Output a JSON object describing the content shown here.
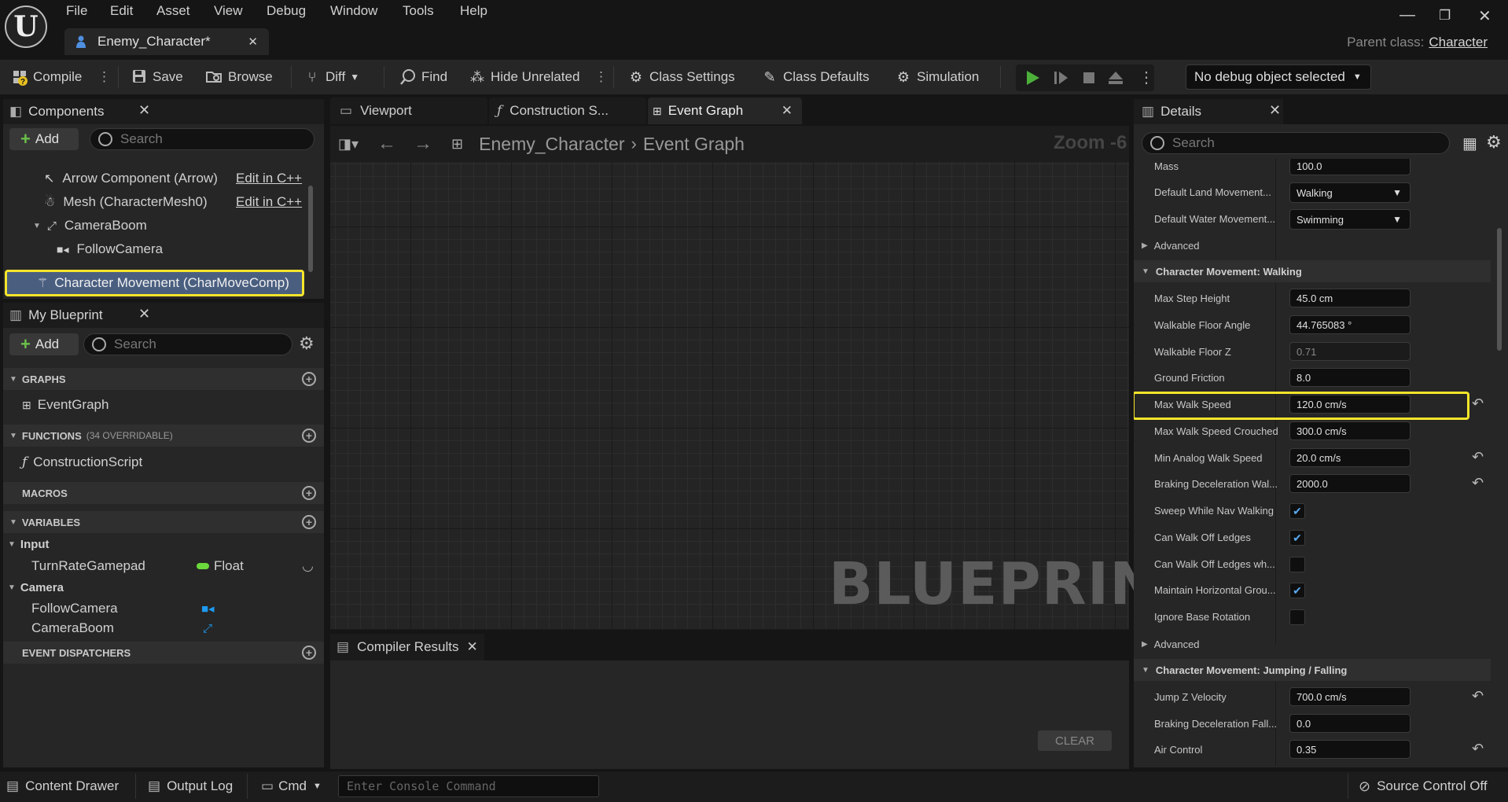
{
  "menu": [
    "File",
    "Edit",
    "Asset",
    "View",
    "Debug",
    "Window",
    "Tools",
    "Help"
  ],
  "document_tab": {
    "label": "Enemy_Character*",
    "close": "✕"
  },
  "parent_class": {
    "prefix": "Parent class:",
    "value": "Character"
  },
  "window_controls": {
    "minimize": "—",
    "restore": "❐",
    "close": "✕"
  },
  "toolbar": {
    "compile": "Compile",
    "save": "Save",
    "browse": "Browse",
    "diff": "Diff",
    "find": "Find",
    "hide_unrelated": "Hide Unrelated",
    "class_settings": "Class Settings",
    "class_defaults": "Class Defaults",
    "simulation": "Simulation",
    "debug_object": "No debug object selected"
  },
  "components_panel": {
    "title": "Components",
    "add": "Add",
    "search_placeholder": "Search",
    "items": [
      {
        "label": "Arrow Component (Arrow)",
        "edit": "Edit in C++"
      },
      {
        "label": "Mesh (CharacterMesh0)",
        "edit": "Edit in C++"
      },
      {
        "label": "CameraBoom"
      },
      {
        "label": "FollowCamera"
      },
      {
        "label": "Character Movement (CharMoveComp)"
      }
    ]
  },
  "my_blueprint": {
    "title": "My Blueprint",
    "add": "Add",
    "search_placeholder": "Search",
    "graphs_header": "GRAPHS",
    "graph_item": "EventGraph",
    "functions_header": "FUNCTIONS",
    "functions_count": "(34 OVERRIDABLE)",
    "function_item": "ConstructionScript",
    "macros_header": "MACROS",
    "variables_header": "VARIABLES",
    "var_group_input": "Input",
    "var_turn": "TurnRateGamepad",
    "var_turn_type": "Float",
    "var_group_camera": "Camera",
    "var_follow": "FollowCamera",
    "var_boom": "CameraBoom",
    "dispatchers_header": "EVENT DISPATCHERS"
  },
  "graph_tabs": {
    "viewport": "Viewport",
    "construction": "Construction S...",
    "event_graph": "Event Graph"
  },
  "graph": {
    "breadcrumb_root": "Enemy_Character",
    "breadcrumb_leaf": "Event Graph",
    "zoom": "Zoom -6",
    "watermark": "BLUEPRINT"
  },
  "compiler": {
    "title": "Compiler Results",
    "clear": "CLEAR"
  },
  "details": {
    "title": "Details",
    "search_placeholder": "Search",
    "mass_label": "Mass",
    "mass_value": "100.0",
    "land_label": "Default Land Movement...",
    "land_value": "Walking",
    "water_label": "Default Water Movement...",
    "water_value": "Swimming",
    "advanced": "Advanced",
    "walking_header": "Character Movement: Walking",
    "step_label": "Max Step Height",
    "step_value": "45.0 cm",
    "floor_angle_label": "Walkable Floor Angle",
    "floor_angle_value": "44.765083 °",
    "floor_z_label": "Walkable Floor Z",
    "floor_z_value": "0.71",
    "friction_label": "Ground Friction",
    "friction_value": "8.0",
    "walk_speed_label": "Max Walk Speed",
    "walk_speed_value": "120.0 cm/s",
    "crouch_label": "Max Walk Speed Crouched",
    "crouch_value": "300.0 cm/s",
    "analog_label": "Min Analog Walk Speed",
    "analog_value": "20.0 cm/s",
    "brake_label": "Braking Deceleration Wal...",
    "brake_value": "2000.0",
    "sweep_label": "Sweep While Nav Walking",
    "ledges_label": "Can Walk Off Ledges",
    "ledges_wh_label": "Can Walk Off Ledges wh...",
    "maintain_label": "Maintain Horizontal Grou...",
    "ignore_label": "Ignore Base Rotation",
    "advanced2": "Advanced",
    "jump_header": "Character Movement: Jumping / Falling",
    "jumpz_label": "Jump Z Velocity",
    "jumpz_value": "700.0 cm/s",
    "brake_fall_label": "Braking Deceleration Fall...",
    "brake_fall_value": "0.0",
    "air_label": "Air Control",
    "air_value": "0.35"
  },
  "statusbar": {
    "content_drawer": "Content Drawer",
    "output_log": "Output Log",
    "cmd": "Cmd",
    "console_placeholder": "Enter Console Command",
    "source_control": "Source Control Off"
  },
  "colors": {
    "highlight": "#f6e52a",
    "play_green": "#4caf3a",
    "selected_row": "#4a5f80",
    "check_blue": "#5aa9f0"
  }
}
